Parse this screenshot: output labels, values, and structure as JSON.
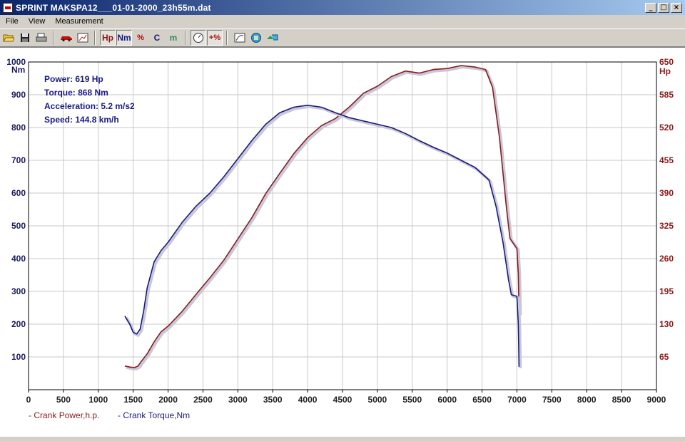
{
  "window": {
    "title": "SPRINT  MAKSPA12___01-01-2000_23h55m.dat",
    "controls": {
      "minimize": "_",
      "maximize": "□",
      "close": "×"
    }
  },
  "menu": {
    "items": [
      "File",
      "View",
      "Measurement"
    ]
  },
  "toolbar": {
    "hp_label": "Hp",
    "nm_label": "Nm",
    "pct_label": "%",
    "c_label": "C",
    "m_label": "m",
    "plus_pct_label": "+%"
  },
  "colors": {
    "power": "#8b1a1a",
    "torque": "#1a1a80",
    "grid": "#c8c8c8",
    "text_dark": "#1a1a60"
  },
  "chart_data": {
    "type": "line",
    "xlim": [
      0,
      9000
    ],
    "x_ticks": [
      0,
      500,
      1000,
      1500,
      2000,
      2500,
      3000,
      3500,
      4000,
      4500,
      5000,
      5500,
      6000,
      6500,
      7000,
      7500,
      8000,
      8500,
      9000
    ],
    "y_left": {
      "unit": "Nm",
      "lim": [
        0,
        1000
      ],
      "ticks": [
        100,
        200,
        300,
        400,
        500,
        600,
        700,
        800,
        900,
        1000
      ]
    },
    "y_right": {
      "unit": "Hp",
      "lim": [
        0,
        650
      ],
      "ticks": [
        65,
        130,
        195,
        260,
        325,
        390,
        455,
        520,
        585,
        650
      ]
    },
    "grid": true,
    "info": [
      "Power: 619 Hp",
      "Torque: 868 Nm",
      "Acceleration: 5.2 m/s2",
      "Speed: 144.8 km/h"
    ],
    "series": [
      {
        "name": "Crank Power,h.p.",
        "axis": "right",
        "color": "#8b1a1a",
        "points": [
          [
            1380,
            47
          ],
          [
            1450,
            45
          ],
          [
            1520,
            44
          ],
          [
            1570,
            47
          ],
          [
            1620,
            57
          ],
          [
            1700,
            71
          ],
          [
            1800,
            95
          ],
          [
            1900,
            115
          ],
          [
            2000,
            126
          ],
          [
            2200,
            155
          ],
          [
            2400,
            189
          ],
          [
            2600,
            222
          ],
          [
            2800,
            257
          ],
          [
            3000,
            299
          ],
          [
            3200,
            341
          ],
          [
            3400,
            389
          ],
          [
            3600,
            429
          ],
          [
            3800,
            468
          ],
          [
            4000,
            500
          ],
          [
            4200,
            524
          ],
          [
            4400,
            538
          ],
          [
            4600,
            561
          ],
          [
            4800,
            588
          ],
          [
            5000,
            602
          ],
          [
            5200,
            621
          ],
          [
            5400,
            632
          ],
          [
            5600,
            628
          ],
          [
            5800,
            635
          ],
          [
            6000,
            637
          ],
          [
            6200,
            643
          ],
          [
            6400,
            640
          ],
          [
            6550,
            635
          ],
          [
            6650,
            600
          ],
          [
            6750,
            500
          ],
          [
            6850,
            360
          ],
          [
            6900,
            300
          ],
          [
            6950,
            290
          ],
          [
            7000,
            280
          ],
          [
            7020,
            230
          ],
          [
            7030,
            150
          ]
        ]
      },
      {
        "name": "Crank Torque,Nm",
        "axis": "left",
        "color": "#1a1a80",
        "points": [
          [
            1380,
            225
          ],
          [
            1450,
            200
          ],
          [
            1500,
            175
          ],
          [
            1550,
            170
          ],
          [
            1600,
            185
          ],
          [
            1650,
            240
          ],
          [
            1700,
            310
          ],
          [
            1800,
            390
          ],
          [
            1900,
            425
          ],
          [
            2000,
            450
          ],
          [
            2200,
            510
          ],
          [
            2400,
            560
          ],
          [
            2600,
            600
          ],
          [
            2800,
            650
          ],
          [
            3000,
            705
          ],
          [
            3200,
            760
          ],
          [
            3400,
            810
          ],
          [
            3600,
            845
          ],
          [
            3800,
            862
          ],
          [
            4000,
            868
          ],
          [
            4200,
            862
          ],
          [
            4400,
            845
          ],
          [
            4600,
            830
          ],
          [
            4800,
            820
          ],
          [
            5000,
            810
          ],
          [
            5200,
            800
          ],
          [
            5400,
            782
          ],
          [
            5600,
            760
          ],
          [
            5800,
            740
          ],
          [
            6000,
            722
          ],
          [
            6200,
            700
          ],
          [
            6400,
            678
          ],
          [
            6600,
            640
          ],
          [
            6700,
            560
          ],
          [
            6800,
            450
          ],
          [
            6880,
            335
          ],
          [
            6920,
            290
          ],
          [
            7000,
            285
          ],
          [
            7020,
            200
          ],
          [
            7030,
            70
          ]
        ]
      }
    ]
  }
}
